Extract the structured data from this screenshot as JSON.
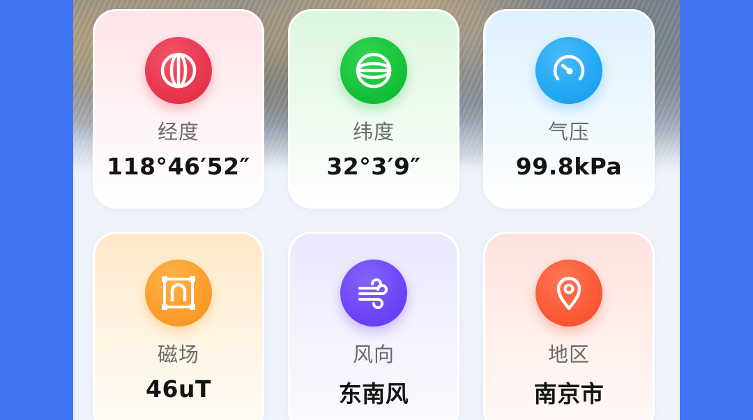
{
  "colors": {
    "longitude": "#e8364f",
    "latitude": "#16c23a",
    "pressure": "#23a8f4",
    "magnetic": "#fb9e2b",
    "wind": "#6d45f6",
    "region": "#fb5a37",
    "background": "#3f74f4"
  },
  "cards": [
    {
      "label": "经度",
      "value": "118°46′52″",
      "icon": "globe-longitude-icon"
    },
    {
      "label": "纬度",
      "value": "32°3′9″",
      "icon": "globe-latitude-icon"
    },
    {
      "label": "气压",
      "value": "99.8kPa",
      "icon": "gauge-icon"
    },
    {
      "label": "磁场",
      "value": "46uT",
      "icon": "magnet-icon"
    },
    {
      "label": "风向",
      "value": "东南风",
      "icon": "wind-icon"
    },
    {
      "label": "地区",
      "value": "南京市",
      "icon": "location-pin-icon"
    }
  ]
}
